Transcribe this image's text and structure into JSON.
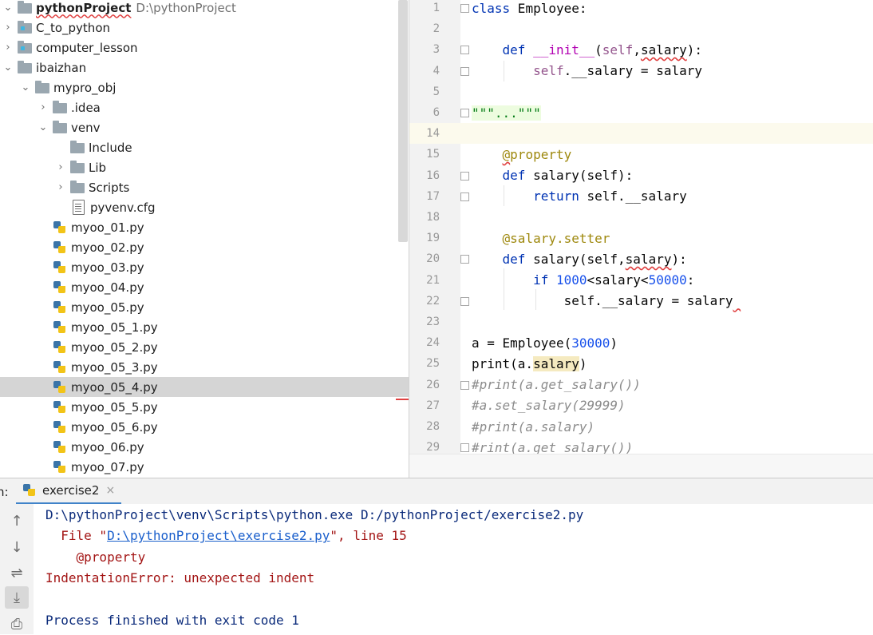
{
  "project": {
    "name": "pythonProject",
    "path": "D:\\pythonProject"
  },
  "tree": [
    {
      "label": "C_to_python",
      "depth": 0,
      "arrow": "›",
      "icon": "module-folder"
    },
    {
      "label": "computer_lesson",
      "depth": 0,
      "arrow": "›",
      "icon": "module-folder"
    },
    {
      "label": "ibaizhan",
      "depth": 0,
      "arrow": "⌄",
      "icon": "folder"
    },
    {
      "label": "mypro_obj",
      "depth": 1,
      "arrow": "⌄",
      "icon": "folder"
    },
    {
      "label": ".idea",
      "depth": 2,
      "arrow": "›",
      "icon": "folder"
    },
    {
      "label": "venv",
      "depth": 2,
      "arrow": "⌄",
      "icon": "folder"
    },
    {
      "label": "Include",
      "depth": 3,
      "arrow": "",
      "icon": "folder"
    },
    {
      "label": "Lib",
      "depth": 3,
      "arrow": "›",
      "icon": "folder"
    },
    {
      "label": "Scripts",
      "depth": 3,
      "arrow": "›",
      "icon": "folder"
    },
    {
      "label": "pyvenv.cfg",
      "depth": 3,
      "arrow": "",
      "icon": "cfg"
    },
    {
      "label": "myoo_01.py",
      "depth": 2,
      "arrow": "",
      "icon": "python"
    },
    {
      "label": "myoo_02.py",
      "depth": 2,
      "arrow": "",
      "icon": "python"
    },
    {
      "label": "myoo_03.py",
      "depth": 2,
      "arrow": "",
      "icon": "python"
    },
    {
      "label": "myoo_04.py",
      "depth": 2,
      "arrow": "",
      "icon": "python"
    },
    {
      "label": "myoo_05.py",
      "depth": 2,
      "arrow": "",
      "icon": "python"
    },
    {
      "label": "myoo_05_1.py",
      "depth": 2,
      "arrow": "",
      "icon": "python"
    },
    {
      "label": "myoo_05_2.py",
      "depth": 2,
      "arrow": "",
      "icon": "python"
    },
    {
      "label": "myoo_05_3.py",
      "depth": 2,
      "arrow": "",
      "icon": "python"
    },
    {
      "label": "myoo_05_4.py",
      "depth": 2,
      "arrow": "",
      "icon": "python",
      "selected": true
    },
    {
      "label": "myoo_05_5.py",
      "depth": 2,
      "arrow": "",
      "icon": "python"
    },
    {
      "label": "myoo_05_6.py",
      "depth": 2,
      "arrow": "",
      "icon": "python"
    },
    {
      "label": "myoo_06.py",
      "depth": 2,
      "arrow": "",
      "icon": "python"
    },
    {
      "label": "myoo_07.py",
      "depth": 2,
      "arrow": "",
      "icon": "python"
    }
  ],
  "editor": {
    "lines": [
      {
        "n": "1",
        "fold": true,
        "html": "<span class=\"kw\">class</span> Employee:"
      },
      {
        "n": "2",
        "html": ""
      },
      {
        "n": "3",
        "fold": true,
        "html": "    <span class=\"kw\">def</span> <span class=\"magic\">__init__</span>(<span class=\"self\">self</span>,<span class=\"squig\">salary</span>):"
      },
      {
        "n": "4",
        "fold": true,
        "html": "        <span class=\"self\">self</span>.__salary = salary"
      },
      {
        "n": "5",
        "html": ""
      },
      {
        "n": "6",
        "fold": true,
        "html": "<span class=\"doc\">\"\"\"...\"\"\"</span>"
      },
      {
        "n": "14",
        "current": true,
        "html": ""
      },
      {
        "n": "15",
        "html": "    <span class=\"deco\"><span class=\"squig\">@</span>property</span>"
      },
      {
        "n": "16",
        "fold": true,
        "html": "    <span class=\"kw\">def</span> salary(self):"
      },
      {
        "n": "17",
        "fold": true,
        "html": "        <span class=\"kw\">return</span> self.__salary"
      },
      {
        "n": "18",
        "html": ""
      },
      {
        "n": "19",
        "html": "    <span class=\"deco\">@salary.setter</span>"
      },
      {
        "n": "20",
        "fold": true,
        "html": "    <span class=\"kw\">def</span> salary(self,<span class=\"squig\">salary</span>):"
      },
      {
        "n": "21",
        "html": "        <span class=\"kw\">if</span> <span class=\"num\">1000</span>&lt;salary&lt;<span class=\"num\">50000</span>:"
      },
      {
        "n": "22",
        "fold": true,
        "html": "            self.__salary = salary<span class=\"squig\"> </span>"
      },
      {
        "n": "23",
        "html": ""
      },
      {
        "n": "24",
        "html": "a = Employee(<span class=\"num\">30000</span>)"
      },
      {
        "n": "25",
        "html": "print(a.<span class=\"hl\">salary</span>)"
      },
      {
        "n": "26",
        "fold": true,
        "html": "<span class=\"cmt\">#print(a.get_salary())</span>"
      },
      {
        "n": "27",
        "html": "<span class=\"cmt\">#a.set_salary(29999)</span>"
      },
      {
        "n": "28",
        "html": "<span class=\"cmt\">#print(a.salary)</span>"
      },
      {
        "n": "29",
        "fold": true,
        "html": "<span class=\"cmt\">#rint(a.get_salary())</span>"
      }
    ]
  },
  "run": {
    "panel_label": "n:",
    "tab_label": "exercise2",
    "close_glyph": "×",
    "toolbar": [
      "↑",
      "↓",
      "⇌",
      "⤓",
      "⎙"
    ],
    "console": [
      {
        "cls": "c-blue",
        "parts": [
          {
            "t": "D:\\pythonProject\\venv\\Scripts\\python.exe D:/pythonProject/exercise2.py"
          }
        ]
      },
      {
        "cls": "c-red",
        "parts": [
          {
            "t": "  File \""
          },
          {
            "t": "D:\\pythonProject\\exercise2.py",
            "link": true
          },
          {
            "t": "\", line 15"
          }
        ]
      },
      {
        "cls": "c-red",
        "parts": [
          {
            "t": "    @property"
          }
        ]
      },
      {
        "cls": "c-red",
        "parts": [
          {
            "t": "IndentationError: unexpected indent"
          }
        ]
      },
      {
        "cls": "c-blue",
        "parts": [
          {
            "t": ""
          }
        ]
      },
      {
        "cls": "c-blue",
        "parts": [
          {
            "t": "Process finished with exit code 1"
          }
        ]
      }
    ]
  },
  "colors": {
    "selection": "#d5d5d5",
    "keyword": "#0033b3",
    "error": "#a31515",
    "link": "#1a5fcc",
    "current_line": "#fcfaed"
  }
}
